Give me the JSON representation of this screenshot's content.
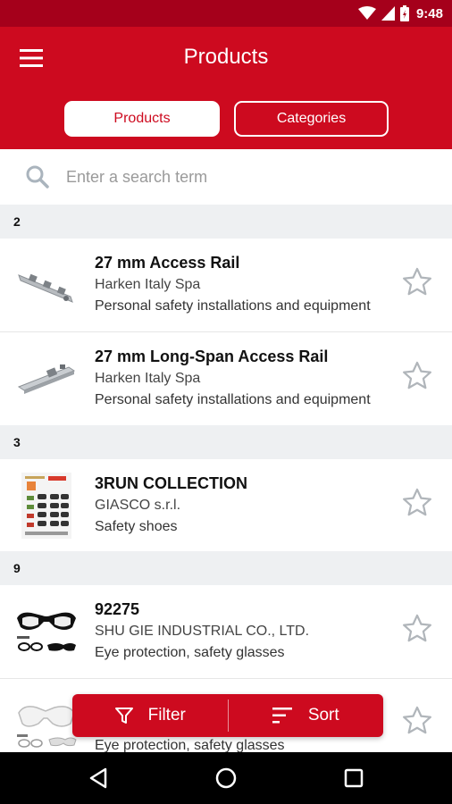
{
  "status_bar": {
    "time": "9:48"
  },
  "header": {
    "title": "Products",
    "segments": {
      "products": "Products",
      "categories": "Categories"
    }
  },
  "search": {
    "placeholder": "Enter a search term"
  },
  "sections": [
    {
      "letter": "2",
      "items": [
        {
          "title": "27 mm Access Rail",
          "company": "Harken Italy Spa",
          "category": "Personal safety installations and equipment"
        },
        {
          "title": "27 mm Long-Span Access Rail",
          "company": "Harken Italy Spa",
          "category": "Personal safety installations and equipment"
        }
      ]
    },
    {
      "letter": "3",
      "items": [
        {
          "title": "3RUN COLLECTION",
          "company": "GIASCO s.r.l.",
          "category": "Safety shoes"
        }
      ]
    },
    {
      "letter": "9",
      "items": [
        {
          "title": "92275",
          "company": "SHU GIE INDUSTRIAL CO., LTD.",
          "category": "Eye protection, safety glasses"
        },
        {
          "category": "Eye protection, safety glasses"
        }
      ]
    }
  ],
  "actions": {
    "filter": "Filter",
    "sort": "Sort"
  },
  "colors": {
    "primary": "#cd0a1f",
    "status_bar": "#a5001b"
  }
}
